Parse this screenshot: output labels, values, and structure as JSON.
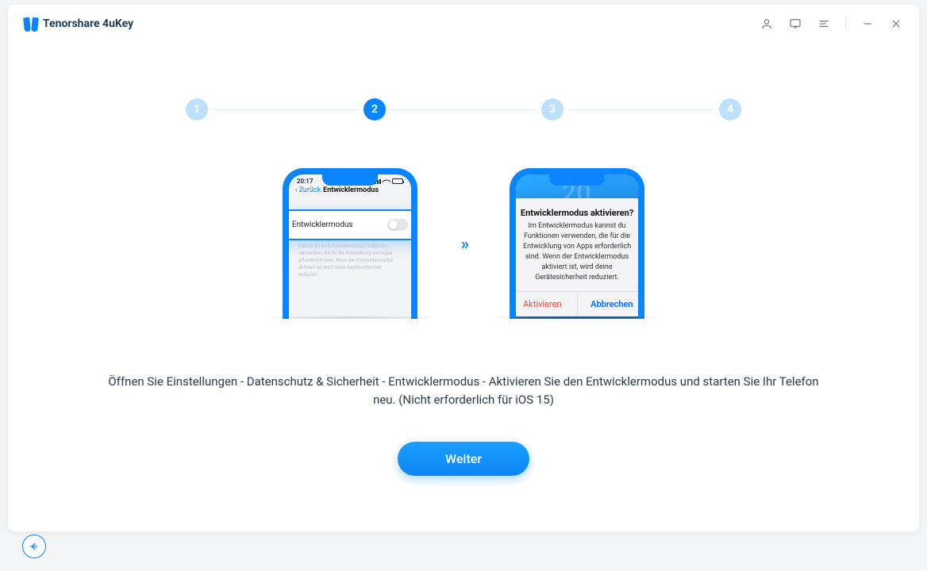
{
  "app_title": "Tenorshare 4uKey",
  "steps": [
    "1",
    "2",
    "3",
    "4"
  ],
  "active_step_index": 1,
  "arrow": "»",
  "phone1": {
    "time": "20:17",
    "back": "Zurück",
    "nav_title": "Entwicklermodus",
    "toggle_label": "Entwicklermodus",
    "hint": "Kannst du im Entwicklermodus Funktionen verwenden, die für die Entwicklung von Apps erforderlich sind. Wenn der Entwicklermodus aktiviert ist, wird deine Gerätesicherheit reduziert."
  },
  "phone2": {
    "lock_time": "20",
    "alert_title": "Entwicklermodus aktivieren?",
    "alert_text": "Im Entwicklermodus kannst du Funktionen verwenden, die für die Entwicklung von Apps erforderlich sind. Wenn der Entwicklermodus aktiviert ist, wird deine Gerätesicherheit reduziert.",
    "confirm": "Aktivieren",
    "cancel": "Abbrechen"
  },
  "instruction": "Öffnen Sie Einstellungen - Datenschutz & Sicherheit - Entwicklermodus - Aktivieren Sie den Entwicklermodus und starten Sie Ihr Telefon neu. (Nicht erforderlich für iOS 15)",
  "cta": "Weiter"
}
